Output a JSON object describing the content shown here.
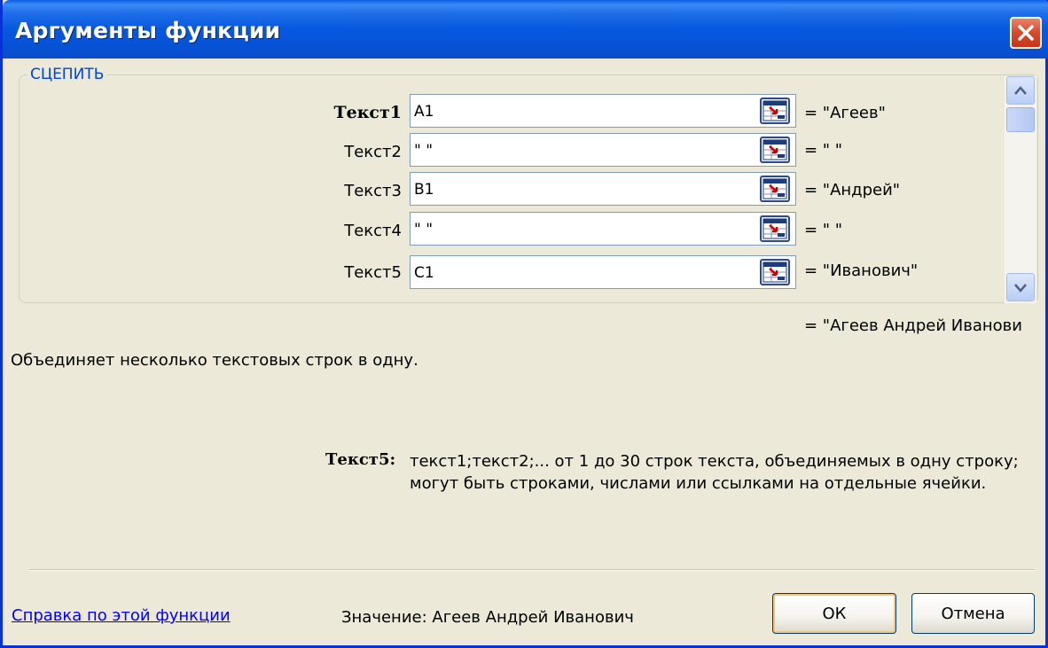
{
  "window": {
    "title": "Аргументы функции"
  },
  "function": {
    "name": "СЦЕПИТЬ"
  },
  "arguments": [
    {
      "label": "Текст1",
      "value": "A1",
      "result": "= \"Агеев\""
    },
    {
      "label": "Текст2",
      "value": "\" \"",
      "result": "= \" \""
    },
    {
      "label": "Текст3",
      "value": "B1",
      "result": "= \"Андрей\""
    },
    {
      "label": "Текст4",
      "value": "\" \"",
      "result": "= \" \""
    },
    {
      "label": "Текст5",
      "value": "C1",
      "result": "= \"Иванович\""
    }
  ],
  "result_preview": "= \"Агеев Андрей Иванови",
  "description": "Объединяет несколько текстовых строк в одну.",
  "help": {
    "arg_label": "Текст5:",
    "text": "текст1;текст2;... от 1 до 30 строк текста, объединяемых в одну строку; могут быть строками, числами или ссылками на отдельные ячейки."
  },
  "footer": {
    "help_link": "Справка по этой функции",
    "value_text": "Значение: Агеев Андрей Иванович",
    "ok_label": "ОК",
    "cancel_label": "Отмена"
  },
  "colors": {
    "titlebar": "#0858e0",
    "accent_label": "#0046d5",
    "link": "#0000ff"
  }
}
